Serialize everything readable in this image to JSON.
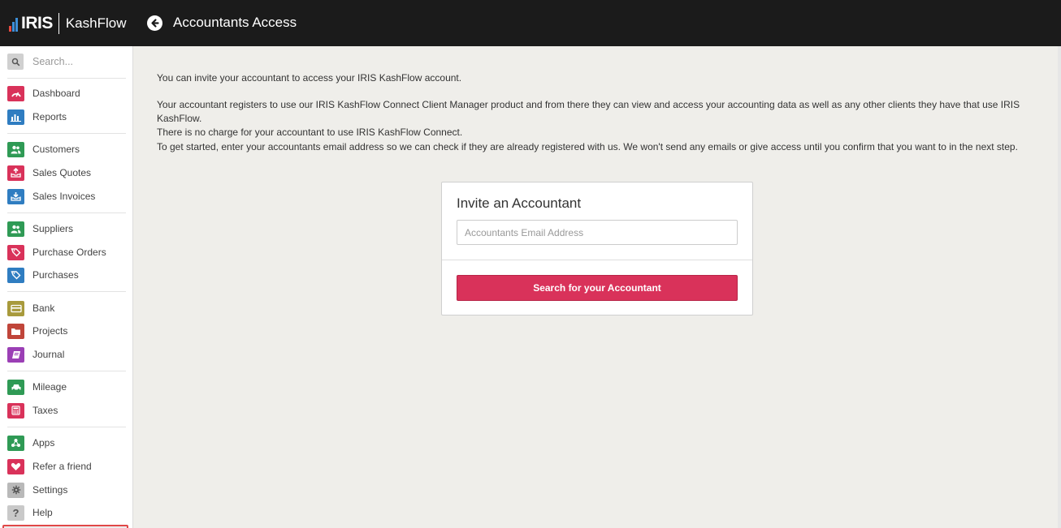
{
  "brand": {
    "logo_text": "IRIS",
    "product": "KashFlow"
  },
  "header": {
    "title": "Accountants Access"
  },
  "sidebar": {
    "search_placeholder": "Search...",
    "items": {
      "dashboard": "Dashboard",
      "reports": "Reports",
      "customers": "Customers",
      "sales_quotes": "Sales Quotes",
      "sales_invoices": "Sales Invoices",
      "suppliers": "Suppliers",
      "purchase_orders": "Purchase Orders",
      "purchases": "Purchases",
      "bank": "Bank",
      "projects": "Projects",
      "journal": "Journal",
      "mileage": "Mileage",
      "taxes": "Taxes",
      "apps": "Apps",
      "refer_a_friend": "Refer a friend",
      "settings": "Settings",
      "help": "Help"
    }
  },
  "main": {
    "intro": "You can invite your accountant to access your IRIS KashFlow account.",
    "description_line1": "Your accountant registers to use our IRIS KashFlow Connect Client Manager product and from there they can view and access your accounting data as well as any other clients they have that use IRIS KashFlow.",
    "description_line2": "There is no charge for your accountant to use IRIS KashFlow Connect.",
    "instructions": "To get started, enter your accountants email address so we can check if they are already registered with us. We won't send any emails or give access until you confirm that you want to in the next step."
  },
  "invite_card": {
    "title": "Invite an Accountant",
    "email_placeholder": "Accountants Email Address",
    "email_value": "",
    "search_button": "Search for your Accountant"
  },
  "colors": {
    "topbar": "#1b1b1b",
    "accent_button": "#d9325a",
    "settings_highlight": "#e04848"
  }
}
